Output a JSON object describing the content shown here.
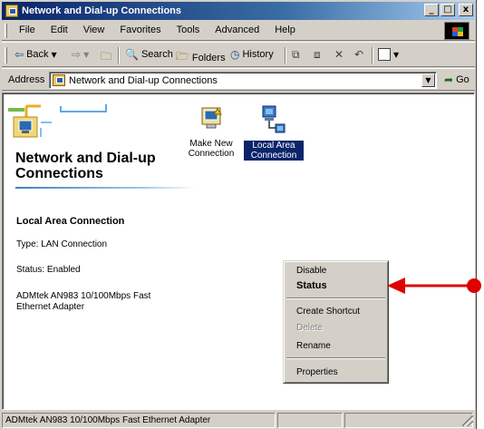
{
  "window": {
    "title": "Network and Dial-up Connections",
    "controls": {
      "minimize": "_",
      "maximize": "□",
      "close": "x"
    }
  },
  "menubar": {
    "items": [
      "File",
      "Edit",
      "View",
      "Favorites",
      "Tools",
      "Advanced",
      "Help"
    ]
  },
  "toolbar": {
    "back_label": "Back",
    "search_label": "Search",
    "folders_label": "Folders",
    "history_label": "History"
  },
  "addressbar": {
    "label": "Address",
    "value": "Network and Dial-up Connections",
    "go_label": "Go"
  },
  "content": {
    "folder_title": "Network and Dial-up Connections",
    "details": {
      "name": "Local Area Connection",
      "type": "Type: LAN Connection",
      "status": "Status: Enabled",
      "adapter": "ADMtek AN983 10/100Mbps Fast Ethernet Adapter"
    },
    "icons": [
      {
        "label": "Make New Connection",
        "selected": false
      },
      {
        "label": "Local Area Connection",
        "selected": true
      }
    ]
  },
  "context_menu": {
    "items": [
      {
        "label": "Disable",
        "style": "normal"
      },
      {
        "label": "Status",
        "style": "bold"
      },
      {
        "label": "Create Shortcut",
        "style": "normal"
      },
      {
        "label": "Delete",
        "style": "disabled"
      },
      {
        "label": "Rename",
        "style": "normal"
      },
      {
        "label": "Properties",
        "style": "normal"
      }
    ]
  },
  "statusbar": {
    "text": "ADMtek AN983 10/100Mbps Fast Ethernet Adapter"
  },
  "colors": {
    "titlebar": "#0a246a",
    "selection": "#0a246a",
    "annotation_arrow": "#e00000"
  }
}
